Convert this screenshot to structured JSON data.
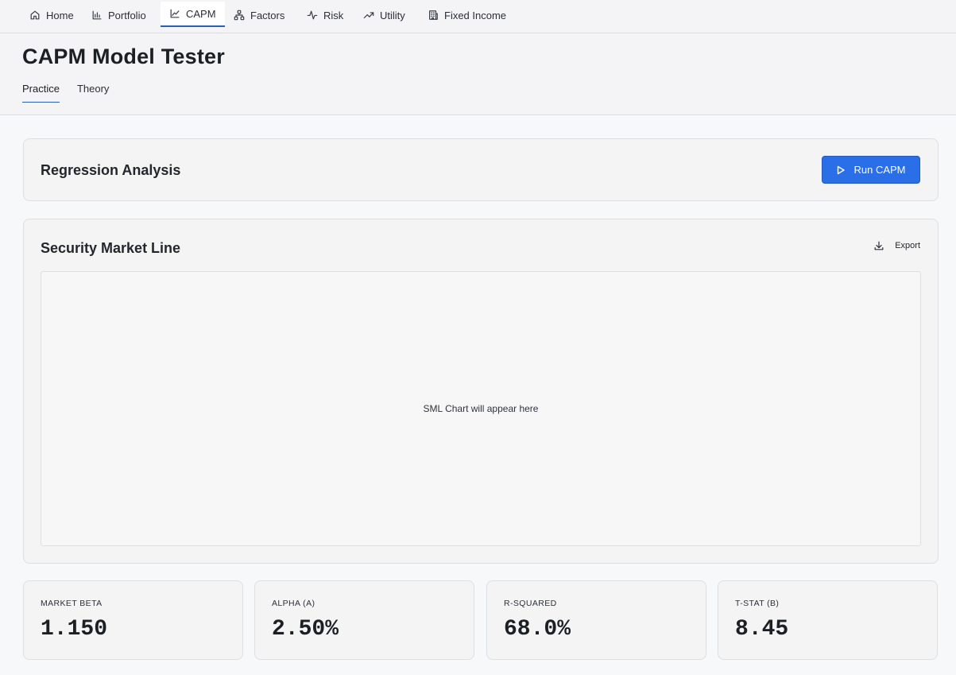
{
  "nav": {
    "items": [
      {
        "label": "Home",
        "icon": "home-icon"
      },
      {
        "label": "Portfolio",
        "icon": "bar-chart-icon"
      },
      {
        "label": "CAPM",
        "icon": "line-chart-icon",
        "active": true
      },
      {
        "label": "Factors",
        "icon": "network-icon"
      },
      {
        "label": "Risk",
        "icon": "activity-icon"
      },
      {
        "label": "Utility",
        "icon": "trending-up-icon"
      },
      {
        "label": "Fixed Income",
        "icon": "building-icon"
      }
    ]
  },
  "header": {
    "title": "CAPM Model Tester",
    "tabs": [
      {
        "label": "Practice",
        "active": true
      },
      {
        "label": "Theory",
        "active": false
      }
    ]
  },
  "regression": {
    "title": "Regression Analysis",
    "run_label": "Run CAPM"
  },
  "sml": {
    "title": "Security Market Line",
    "export_label": "Export",
    "placeholder": "SML Chart will appear here"
  },
  "metrics": [
    {
      "label": "MARKET BETA",
      "value": "1.150"
    },
    {
      "label": "ALPHA (A)",
      "value": "2.50%"
    },
    {
      "label": "R-SQUARED",
      "value": "68.0%"
    },
    {
      "label": "T-STAT (B)",
      "value": "8.45"
    }
  ],
  "colors": {
    "accent": "#2a6ee8",
    "active_underline": "#2f5fb0"
  }
}
